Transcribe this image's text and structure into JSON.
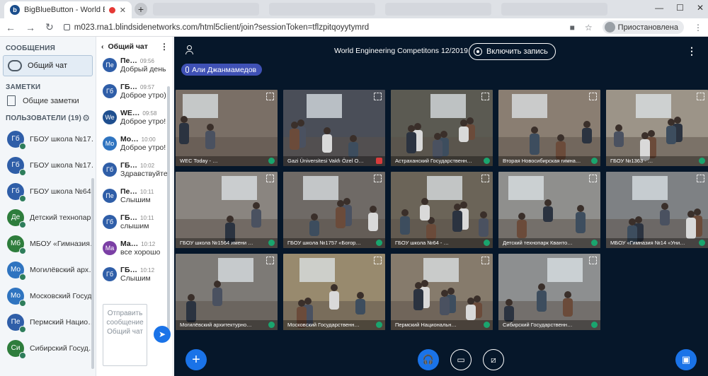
{
  "browser": {
    "tab_title": "BigBlueButton - World Engin",
    "tab_logo": "b",
    "url": "m023.rna1.blindsidenetworks.com/html5client/join?sessionToken=tflzpitqoyytymrd",
    "profile_label": "Приостановлена"
  },
  "sidebar": {
    "messages_title": "СООБЩЕНИЯ",
    "public_chat": "Общий чат",
    "notes_title": "ЗАМЕТКИ",
    "shared_notes": "Общие заметки",
    "users_title": "ПОЛЬЗОВАТЕЛИ (19)",
    "users": [
      {
        "initials": "Гб",
        "name": "ГБОУ школа №17…",
        "color": "#2f5ea8"
      },
      {
        "initials": "Гб",
        "name": "ГБОУ школа №17…",
        "color": "#2f5ea8"
      },
      {
        "initials": "Гб",
        "name": "ГБОУ школа №64",
        "color": "#2f5ea8"
      },
      {
        "initials": "Де",
        "name": "Детский технопар…",
        "color": "#2e7d3c"
      },
      {
        "initials": "Мб",
        "name": "МБОУ «Гимназия…",
        "color": "#2e7d3c"
      },
      {
        "initials": "Мо",
        "name": "Могилёвский арх…",
        "color": "#2f74c0"
      },
      {
        "initials": "Мо",
        "name": "Московский Госуд…",
        "color": "#2f74c0"
      },
      {
        "initials": "Пе",
        "name": "Пермский Нацио…",
        "color": "#2f5ea8"
      },
      {
        "initials": "Си",
        "name": "Сибирский Госуд…",
        "color": "#2e7d3c"
      }
    ]
  },
  "chat": {
    "title": "Общий чат",
    "input_placeholder": "Отправить сообщение Общий чат",
    "messages": [
      {
        "initials": "Пе",
        "name": "Пе…",
        "time": "09:56",
        "text": "Добрый день",
        "color": "#2f5ea8"
      },
      {
        "initials": "Гб",
        "name": "ГБ…",
        "time": "09:57",
        "text": "Доброе утро)",
        "color": "#2f5ea8"
      },
      {
        "initials": "We",
        "name": "WE…",
        "time": "09:58",
        "text": "Доброе утро!",
        "color": "#1f4f8f"
      },
      {
        "initials": "Мо",
        "name": "Мо…",
        "time": "10:00",
        "text": "Доброе утро!",
        "color": "#2f74c0"
      },
      {
        "initials": "Гб",
        "name": "ГБ…",
        "time": "10:02",
        "text": "Здравствуйте!",
        "color": "#2f5ea8"
      },
      {
        "initials": "Пе",
        "name": "Пе…",
        "time": "10:11",
        "text": "Слышим",
        "color": "#2f5ea8"
      },
      {
        "initials": "Гб",
        "name": "ГБ…",
        "time": "10:11",
        "text": "слышим",
        "color": "#2f5ea8"
      },
      {
        "initials": "Ма",
        "name": "Ма…",
        "time": "10:12",
        "text": "все хорошо",
        "color": "#7b3fa5"
      },
      {
        "initials": "Гб",
        "name": "ГБ…",
        "time": "10:12",
        "text": "Слышим",
        "color": "#2f5ea8"
      }
    ]
  },
  "meeting": {
    "title": "World Engineering Competitons 12/2019",
    "record_label": "Включить запись",
    "talking": "Али Джанмамедов"
  },
  "videos": [
    {
      "label": "WEC Today - …",
      "bg": "#7a6f66",
      "muted": false
    },
    {
      "label": "Gazi Üniversitesi Vakfı Özel O…",
      "bg": "#4a4e58",
      "muted": true
    },
    {
      "label": "Астраханский Государственн…",
      "bg": "#5b5a52",
      "muted": false
    },
    {
      "label": "Вторая Новосибирская гимна…",
      "bg": "#8a7e72",
      "muted": false
    },
    {
      "label": "ГБОУ №1363 - …",
      "bg": "#9c9488",
      "muted": false
    },
    {
      "label": "ГБОУ школа №1564 имени …",
      "bg": "#8a8580",
      "muted": false
    },
    {
      "label": "ГБОУ школа №1757 «Богор…",
      "bg": "#6f6a66",
      "muted": false
    },
    {
      "label": "ГБОУ школа №64 - …",
      "bg": "#6b6458",
      "muted": false
    },
    {
      "label": "Детский технопарк Кванто…",
      "bg": "#8f8f8d",
      "muted": false
    },
    {
      "label": "МБОУ «Гимназия №14 «Уни…",
      "bg": "#7e8184",
      "muted": false
    },
    {
      "label": "Могилёвский архитектурно…",
      "bg": "#7d7a76",
      "muted": false
    },
    {
      "label": "Московский Государственн…",
      "bg": "#988a6e",
      "muted": false
    },
    {
      "label": "Пермский Национальн…",
      "bg": "#867b6c",
      "muted": false
    },
    {
      "label": "Сибирский Государственн…",
      "bg": "#8d8f90",
      "muted": false
    }
  ]
}
